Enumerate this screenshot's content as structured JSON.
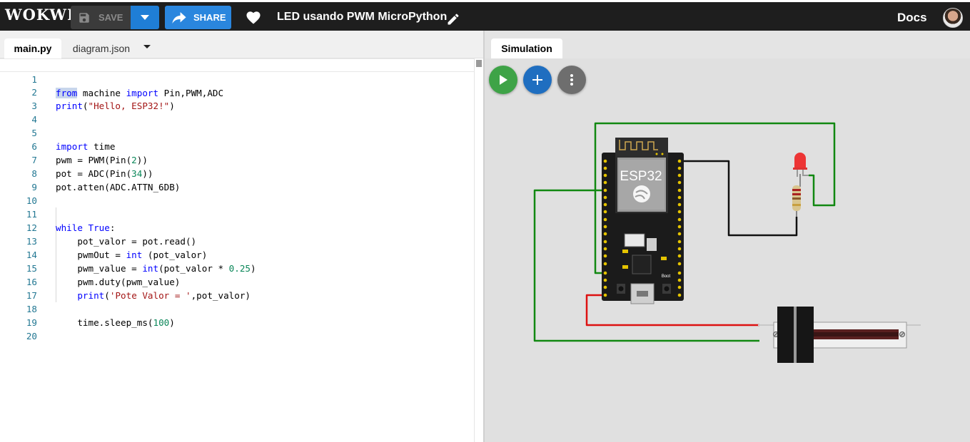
{
  "header": {
    "logo": "WOKWI",
    "save_label": "SAVE",
    "share_label": "SHARE",
    "project_title": "LED usando PWM MicroPython",
    "docs_label": "Docs"
  },
  "editor": {
    "tabs": [
      {
        "label": "main.py",
        "active": true
      },
      {
        "label": "diagram.json",
        "active": false
      }
    ],
    "line_numbers": [
      "1",
      "2",
      "3",
      "4",
      "5",
      "6",
      "7",
      "8",
      "9",
      "10",
      "11",
      "12",
      "13",
      "14",
      "15",
      "16",
      "17",
      "18",
      "19",
      "20"
    ],
    "lines": [
      "from machine import Pin,PWM,ADC",
      "print(\"Hello, ESP32!\")",
      "",
      "",
      "import time",
      "pwm = PWM(Pin(2))",
      "pot = ADC(Pin(34))",
      "pot.atten(ADC.ATTN_6DB)",
      "",
      "",
      "while True:",
      "    pot_valor = pot.read()",
      "    pwmOut = int (pot_valor)",
      "    pwm_value = int(pot_valor * 0.25)",
      "    pwm.duty(pwm_value)",
      "    print('Pote Valor = ',pot_valor)",
      "",
      "    time.sleep_ms(100)",
      "",
      ""
    ]
  },
  "simulation": {
    "tab_label": "Simulation",
    "board_label": "ESP32",
    "boot_label": "Boot",
    "buttons": [
      "play-icon",
      "plus-icon",
      "more-vertical-icon"
    ]
  },
  "colors": {
    "topbar": "#1e1e1e",
    "accent_blue": "#2a86de",
    "play_green": "#3ea347",
    "wire_green": "#118811",
    "wire_red": "#dd1111",
    "wire_black": "#111111"
  }
}
